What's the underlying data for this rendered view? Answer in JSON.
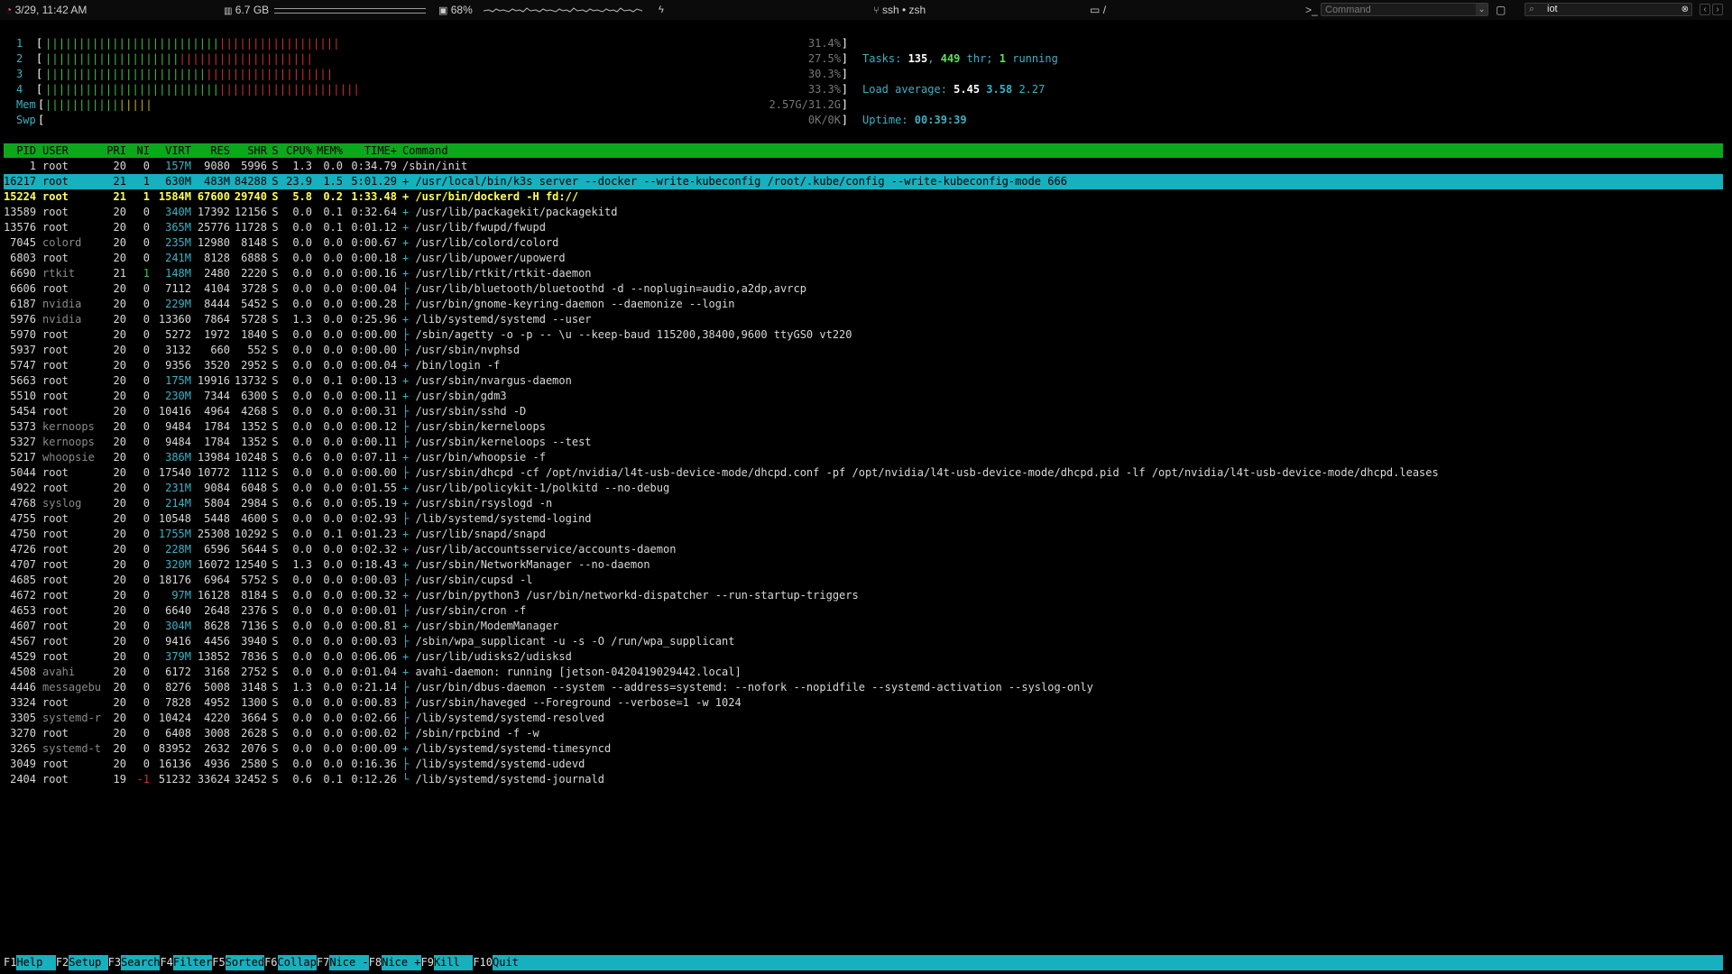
{
  "topbar": {
    "datetime": "3/29, 11:42 AM",
    "memory": "6.7 GB",
    "cpu": "68%",
    "title": "ssh • zsh",
    "folder": "/",
    "command_placeholder": "Command",
    "search_value": "iot"
  },
  "meters": {
    "cpus": [
      {
        "label": "1",
        "value": "31.4%",
        "green": 26,
        "red": 18
      },
      {
        "label": "2",
        "value": "27.5%",
        "green": 20,
        "red": 20
      },
      {
        "label": "3",
        "value": "30.3%",
        "green": 24,
        "red": 19
      },
      {
        "label": "4",
        "value": "33.3%",
        "green": 26,
        "red": 21
      }
    ],
    "mem": {
      "label": "Mem",
      "value": "2.57G/31.2G",
      "green": 11,
      "yellow": 5
    },
    "swp": {
      "label": "Swp",
      "value": "0K/0K"
    }
  },
  "info": {
    "tasks_label": "Tasks: ",
    "tasks": "135",
    "sep1": ", ",
    "threads": "449",
    "thr_label": " thr; ",
    "running": "1",
    "running_label": " running",
    "load_label": "Load average: ",
    "load1": "5.45",
    "load5": "3.58",
    "load15": "2.27",
    "uptime_label": "Uptime: ",
    "uptime": "00:39:39"
  },
  "header": {
    "pid": "PID",
    "user": "USER",
    "pri": "PRI",
    "ni": "NI",
    "virt": "VIRT",
    "res": "RES",
    "shr": "SHR",
    "s": "S",
    "cpu": "CPU%",
    "mem": "MEM%",
    "time": "TIME+",
    "cmd": "Command"
  },
  "processes": [
    {
      "pid": "1",
      "user": "root",
      "pri": "20",
      "ni": "0",
      "virt": "157M",
      "res": "9080",
      "shr": "5996",
      "s": "S",
      "cpu": "1.3",
      "mem": "0.0",
      "time": "0:34.79",
      "tree": "",
      "cmd": "/sbin/init"
    },
    {
      "pid": "16217",
      "user": "root",
      "pri": "21",
      "ni": "1",
      "virt": "630M",
      "res": "483M",
      "shr": "84288",
      "s": "S",
      "cpu": "23.9",
      "mem": "1.5",
      "time": "5:01.29",
      "tree": "+ ",
      "cmd": "/usr/local/bin/k3s server --docker --write-kubeconfig /root/.kube/config --write-kubeconfig-mode 666",
      "state": "sel"
    },
    {
      "pid": "15224",
      "user": "root",
      "pri": "21",
      "ni": "1",
      "virt": "1584M",
      "res": "67600",
      "shr": "29740",
      "s": "S",
      "cpu": "5.8",
      "mem": "0.2",
      "time": "1:33.48",
      "tree": "+ ",
      "cmd": "/usr/bin/dockerd -H fd://",
      "state": "hl"
    },
    {
      "pid": "13589",
      "user": "root",
      "pri": "20",
      "ni": "0",
      "virt": "340M",
      "res": "17392",
      "shr": "12156",
      "s": "S",
      "cpu": "0.0",
      "mem": "0.1",
      "time": "0:32.64",
      "tree": "+ ",
      "cmd": "/usr/lib/packagekit/packagekitd"
    },
    {
      "pid": "13576",
      "user": "root",
      "pri": "20",
      "ni": "0",
      "virt": "365M",
      "res": "25776",
      "shr": "11728",
      "s": "S",
      "cpu": "0.0",
      "mem": "0.1",
      "time": "0:01.12",
      "tree": "+ ",
      "cmd": "/usr/lib/fwupd/fwupd"
    },
    {
      "pid": "7045",
      "user": "colord",
      "pri": "20",
      "ni": "0",
      "virt": "235M",
      "res": "12980",
      "shr": "8148",
      "s": "S",
      "cpu": "0.0",
      "mem": "0.0",
      "time": "0:00.67",
      "tree": "+ ",
      "cmd": "/usr/lib/colord/colord",
      "dimuser": true
    },
    {
      "pid": "6803",
      "user": "root",
      "pri": "20",
      "ni": "0",
      "virt": "241M",
      "res": "8128",
      "shr": "6888",
      "s": "S",
      "cpu": "0.0",
      "mem": "0.0",
      "time": "0:00.18",
      "tree": "+ ",
      "cmd": "/usr/lib/upower/upowerd"
    },
    {
      "pid": "6690",
      "user": "rtkit",
      "pri": "21",
      "ni": "1",
      "virt": "148M",
      "res": "2480",
      "shr": "2220",
      "s": "S",
      "cpu": "0.0",
      "mem": "0.0",
      "time": "0:00.16",
      "tree": "+ ",
      "cmd": "/usr/lib/rtkit/rtkit-daemon",
      "dimuser": true,
      "nicolor": "g"
    },
    {
      "pid": "6606",
      "user": "root",
      "pri": "20",
      "ni": "0",
      "virt": "7112",
      "res": "4104",
      "shr": "3728",
      "s": "S",
      "cpu": "0.0",
      "mem": "0.0",
      "time": "0:00.04",
      "tree": "├ ",
      "cmd": "/usr/lib/bluetooth/bluetoothd -d --noplugin=audio,a2dp,avrcp"
    },
    {
      "pid": "6187",
      "user": "nvidia",
      "pri": "20",
      "ni": "0",
      "virt": "229M",
      "res": "8444",
      "shr": "5452",
      "s": "S",
      "cpu": "0.0",
      "mem": "0.0",
      "time": "0:00.28",
      "tree": "├ ",
      "cmd": "/usr/bin/gnome-keyring-daemon --daemonize --login",
      "dimuser": true
    },
    {
      "pid": "5976",
      "user": "nvidia",
      "pri": "20",
      "ni": "0",
      "virt": "13360",
      "res": "7864",
      "shr": "5728",
      "s": "S",
      "cpu": "1.3",
      "mem": "0.0",
      "time": "0:25.96",
      "tree": "+ ",
      "cmd": "/lib/systemd/systemd --user",
      "dimuser": true
    },
    {
      "pid": "5970",
      "user": "root",
      "pri": "20",
      "ni": "0",
      "virt": "5272",
      "res": "1972",
      "shr": "1840",
      "s": "S",
      "cpu": "0.0",
      "mem": "0.0",
      "time": "0:00.00",
      "tree": "├ ",
      "cmd": "/sbin/agetty -o -p -- \\u --keep-baud 115200,38400,9600 ttyGS0 vt220"
    },
    {
      "pid": "5937",
      "user": "root",
      "pri": "20",
      "ni": "0",
      "virt": "3132",
      "res": "660",
      "shr": "552",
      "s": "S",
      "cpu": "0.0",
      "mem": "0.0",
      "time": "0:00.00",
      "tree": "├ ",
      "cmd": "/usr/sbin/nvphsd"
    },
    {
      "pid": "5747",
      "user": "root",
      "pri": "20",
      "ni": "0",
      "virt": "9356",
      "res": "3520",
      "shr": "2952",
      "s": "S",
      "cpu": "0.0",
      "mem": "0.0",
      "time": "0:00.04",
      "tree": "+ ",
      "cmd": "/bin/login -f"
    },
    {
      "pid": "5663",
      "user": "root",
      "pri": "20",
      "ni": "0",
      "virt": "175M",
      "res": "19916",
      "shr": "13732",
      "s": "S",
      "cpu": "0.0",
      "mem": "0.1",
      "time": "0:00.13",
      "tree": "+ ",
      "cmd": "/usr/sbin/nvargus-daemon"
    },
    {
      "pid": "5510",
      "user": "root",
      "pri": "20",
      "ni": "0",
      "virt": "230M",
      "res": "7344",
      "shr": "6300",
      "s": "S",
      "cpu": "0.0",
      "mem": "0.0",
      "time": "0:00.11",
      "tree": "+ ",
      "cmd": "/usr/sbin/gdm3"
    },
    {
      "pid": "5454",
      "user": "root",
      "pri": "20",
      "ni": "0",
      "virt": "10416",
      "res": "4964",
      "shr": "4268",
      "s": "S",
      "cpu": "0.0",
      "mem": "0.0",
      "time": "0:00.31",
      "tree": "├ ",
      "cmd": "/usr/sbin/sshd -D"
    },
    {
      "pid": "5373",
      "user": "kernoops",
      "pri": "20",
      "ni": "0",
      "virt": "9484",
      "res": "1784",
      "shr": "1352",
      "s": "S",
      "cpu": "0.0",
      "mem": "0.0",
      "time": "0:00.12",
      "tree": "├ ",
      "cmd": "/usr/sbin/kerneloops",
      "dimuser": true
    },
    {
      "pid": "5327",
      "user": "kernoops",
      "pri": "20",
      "ni": "0",
      "virt": "9484",
      "res": "1784",
      "shr": "1352",
      "s": "S",
      "cpu": "0.0",
      "mem": "0.0",
      "time": "0:00.11",
      "tree": "├ ",
      "cmd": "/usr/sbin/kerneloops --test",
      "dimuser": true
    },
    {
      "pid": "5217",
      "user": "whoopsie",
      "pri": "20",
      "ni": "0",
      "virt": "386M",
      "res": "13984",
      "shr": "10248",
      "s": "S",
      "cpu": "0.6",
      "mem": "0.0",
      "time": "0:07.11",
      "tree": "+ ",
      "cmd": "/usr/bin/whoopsie -f",
      "dimuser": true
    },
    {
      "pid": "5044",
      "user": "root",
      "pri": "20",
      "ni": "0",
      "virt": "17540",
      "res": "10772",
      "shr": "1112",
      "s": "S",
      "cpu": "0.0",
      "mem": "0.0",
      "time": "0:00.00",
      "tree": "├ ",
      "cmd": "/usr/sbin/dhcpd -cf /opt/nvidia/l4t-usb-device-mode/dhcpd.conf -pf /opt/nvidia/l4t-usb-device-mode/dhcpd.pid -lf /opt/nvidia/l4t-usb-device-mode/dhcpd.leases"
    },
    {
      "pid": "4922",
      "user": "root",
      "pri": "20",
      "ni": "0",
      "virt": "231M",
      "res": "9084",
      "shr": "6048",
      "s": "S",
      "cpu": "0.0",
      "mem": "0.0",
      "time": "0:01.55",
      "tree": "+ ",
      "cmd": "/usr/lib/policykit-1/polkitd --no-debug"
    },
    {
      "pid": "4768",
      "user": "syslog",
      "pri": "20",
      "ni": "0",
      "virt": "214M",
      "res": "5804",
      "shr": "2984",
      "s": "S",
      "cpu": "0.6",
      "mem": "0.0",
      "time": "0:05.19",
      "tree": "+ ",
      "cmd": "/usr/sbin/rsyslogd -n",
      "dimuser": true
    },
    {
      "pid": "4755",
      "user": "root",
      "pri": "20",
      "ni": "0",
      "virt": "10548",
      "res": "5448",
      "shr": "4600",
      "s": "S",
      "cpu": "0.0",
      "mem": "0.0",
      "time": "0:02.93",
      "tree": "├ ",
      "cmd": "/lib/systemd/systemd-logind"
    },
    {
      "pid": "4750",
      "user": "root",
      "pri": "20",
      "ni": "0",
      "virt": "1755M",
      "res": "25308",
      "shr": "10292",
      "s": "S",
      "cpu": "0.0",
      "mem": "0.1",
      "time": "0:01.23",
      "tree": "+ ",
      "cmd": "/usr/lib/snapd/snapd"
    },
    {
      "pid": "4726",
      "user": "root",
      "pri": "20",
      "ni": "0",
      "virt": "228M",
      "res": "6596",
      "shr": "5644",
      "s": "S",
      "cpu": "0.0",
      "mem": "0.0",
      "time": "0:02.32",
      "tree": "+ ",
      "cmd": "/usr/lib/accountsservice/accounts-daemon"
    },
    {
      "pid": "4707",
      "user": "root",
      "pri": "20",
      "ni": "0",
      "virt": "320M",
      "res": "16072",
      "shr": "12540",
      "s": "S",
      "cpu": "1.3",
      "mem": "0.0",
      "time": "0:18.43",
      "tree": "+ ",
      "cmd": "/usr/sbin/NetworkManager --no-daemon"
    },
    {
      "pid": "4685",
      "user": "root",
      "pri": "20",
      "ni": "0",
      "virt": "18176",
      "res": "6964",
      "shr": "5752",
      "s": "S",
      "cpu": "0.0",
      "mem": "0.0",
      "time": "0:00.03",
      "tree": "├ ",
      "cmd": "/usr/sbin/cupsd -l"
    },
    {
      "pid": "4672",
      "user": "root",
      "pri": "20",
      "ni": "0",
      "virt": "97M",
      "res": "16128",
      "shr": "8184",
      "s": "S",
      "cpu": "0.0",
      "mem": "0.0",
      "time": "0:00.32",
      "tree": "+ ",
      "cmd": "/usr/bin/python3 /usr/bin/networkd-dispatcher --run-startup-triggers"
    },
    {
      "pid": "4653",
      "user": "root",
      "pri": "20",
      "ni": "0",
      "virt": "6640",
      "res": "2648",
      "shr": "2376",
      "s": "S",
      "cpu": "0.0",
      "mem": "0.0",
      "time": "0:00.01",
      "tree": "├ ",
      "cmd": "/usr/sbin/cron -f"
    },
    {
      "pid": "4607",
      "user": "root",
      "pri": "20",
      "ni": "0",
      "virt": "304M",
      "res": "8628",
      "shr": "7136",
      "s": "S",
      "cpu": "0.0",
      "mem": "0.0",
      "time": "0:00.81",
      "tree": "+ ",
      "cmd": "/usr/sbin/ModemManager"
    },
    {
      "pid": "4567",
      "user": "root",
      "pri": "20",
      "ni": "0",
      "virt": "9416",
      "res": "4456",
      "shr": "3940",
      "s": "S",
      "cpu": "0.0",
      "mem": "0.0",
      "time": "0:00.03",
      "tree": "├ ",
      "cmd": "/sbin/wpa_supplicant -u -s -O /run/wpa_supplicant"
    },
    {
      "pid": "4529",
      "user": "root",
      "pri": "20",
      "ni": "0",
      "virt": "379M",
      "res": "13852",
      "shr": "7836",
      "s": "S",
      "cpu": "0.0",
      "mem": "0.0",
      "time": "0:06.06",
      "tree": "+ ",
      "cmd": "/usr/lib/udisks2/udisksd"
    },
    {
      "pid": "4508",
      "user": "avahi",
      "pri": "20",
      "ni": "0",
      "virt": "6172",
      "res": "3168",
      "shr": "2752",
      "s": "S",
      "cpu": "0.0",
      "mem": "0.0",
      "time": "0:01.04",
      "tree": "+ ",
      "cmd": "avahi-daemon: running [jetson-0420419029442.local]",
      "dimuser": true
    },
    {
      "pid": "4446",
      "user": "messagebu",
      "pri": "20",
      "ni": "0",
      "virt": "8276",
      "res": "5008",
      "shr": "3148",
      "s": "S",
      "cpu": "1.3",
      "mem": "0.0",
      "time": "0:21.14",
      "tree": "├ ",
      "cmd": "/usr/bin/dbus-daemon --system --address=systemd: --nofork --nopidfile --systemd-activation --syslog-only",
      "dimuser": true
    },
    {
      "pid": "3324",
      "user": "root",
      "pri": "20",
      "ni": "0",
      "virt": "7828",
      "res": "4952",
      "shr": "1300",
      "s": "S",
      "cpu": "0.0",
      "mem": "0.0",
      "time": "0:00.83",
      "tree": "├ ",
      "cmd": "/usr/sbin/haveged --Foreground --verbose=1 -w 1024"
    },
    {
      "pid": "3305",
      "user": "systemd-r",
      "pri": "20",
      "ni": "0",
      "virt": "10424",
      "res": "4220",
      "shr": "3664",
      "s": "S",
      "cpu": "0.0",
      "mem": "0.0",
      "time": "0:02.66",
      "tree": "├ ",
      "cmd": "/lib/systemd/systemd-resolved",
      "dimuser": true
    },
    {
      "pid": "3270",
      "user": "root",
      "pri": "20",
      "ni": "0",
      "virt": "6408",
      "res": "3008",
      "shr": "2628",
      "s": "S",
      "cpu": "0.0",
      "mem": "0.0",
      "time": "0:00.02",
      "tree": "├ ",
      "cmd": "/sbin/rpcbind -f -w"
    },
    {
      "pid": "3265",
      "user": "systemd-t",
      "pri": "20",
      "ni": "0",
      "virt": "83952",
      "res": "2632",
      "shr": "2076",
      "s": "S",
      "cpu": "0.0",
      "mem": "0.0",
      "time": "0:00.09",
      "tree": "+ ",
      "cmd": "/lib/systemd/systemd-timesyncd",
      "dimuser": true
    },
    {
      "pid": "3049",
      "user": "root",
      "pri": "20",
      "ni": "0",
      "virt": "16136",
      "res": "4936",
      "shr": "2580",
      "s": "S",
      "cpu": "0.0",
      "mem": "0.0",
      "time": "0:16.36",
      "tree": "├ ",
      "cmd": "/lib/systemd/systemd-udevd"
    },
    {
      "pid": "2404",
      "user": "root",
      "pri": "19",
      "ni": "-1",
      "virt": "51232",
      "res": "33624",
      "shr": "32452",
      "s": "S",
      "cpu": "0.6",
      "mem": "0.1",
      "time": "0:12.26",
      "tree": "└ ",
      "cmd": "/lib/systemd/systemd-journald",
      "nicolor": "r"
    }
  ],
  "footer": [
    {
      "key": "F1",
      "label": "Help  "
    },
    {
      "key": "F2",
      "label": "Setup "
    },
    {
      "key": "F3",
      "label": "Search"
    },
    {
      "key": "F4",
      "label": "Filter"
    },
    {
      "key": "F5",
      "label": "Sorted"
    },
    {
      "key": "F6",
      "label": "Collap"
    },
    {
      "key": "F7",
      "label": "Nice -"
    },
    {
      "key": "F8",
      "label": "Nice +"
    },
    {
      "key": "F9",
      "label": "Kill  "
    },
    {
      "key": "F10",
      "label": "Quit  "
    }
  ],
  "colors": {
    "header_bg": "#0ca81c",
    "selection_bg": "#16b0bf",
    "highlight_fg": "#ffff55",
    "cyan": "#3cb1c4"
  }
}
